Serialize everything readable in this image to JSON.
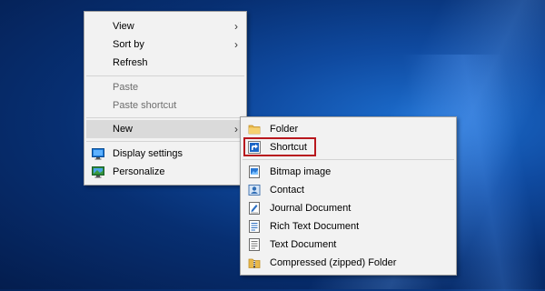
{
  "context_menu": {
    "items": [
      {
        "label": "View"
      },
      {
        "label": "Sort by"
      },
      {
        "label": "Refresh"
      },
      {
        "label": "Paste"
      },
      {
        "label": "Paste shortcut"
      },
      {
        "label": "New"
      },
      {
        "label": "Display settings"
      },
      {
        "label": "Personalize"
      }
    ],
    "submenu_arrow": "›"
  },
  "new_submenu": {
    "items": [
      {
        "label": "Folder",
        "icon": "folder-icon"
      },
      {
        "label": "Shortcut",
        "icon": "shortcut-icon"
      },
      {
        "label": "Bitmap image",
        "icon": "bitmap-image-icon"
      },
      {
        "label": "Contact",
        "icon": "contact-icon"
      },
      {
        "label": "Journal Document",
        "icon": "journal-document-icon"
      },
      {
        "label": "Rich Text Document",
        "icon": "rich-text-document-icon"
      },
      {
        "label": "Text Document",
        "icon": "text-document-icon"
      },
      {
        "label": "Compressed (zipped) Folder",
        "icon": "zip-folder-icon"
      }
    ],
    "highlight_color": "#b8181e"
  },
  "colors": {
    "menu_bg": "#f2f2f2",
    "hover_bg": "#dadada",
    "disabled_text": "#6d6d6d",
    "desktop_blue": "#0f4aa0"
  }
}
